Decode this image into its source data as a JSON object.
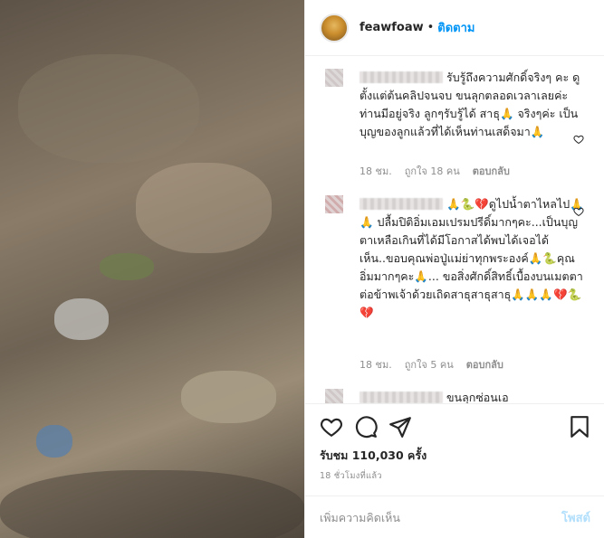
{
  "header": {
    "username": "feawfoaw",
    "separator": "•",
    "follow_label": "ติดตาม"
  },
  "comments": [
    {
      "text": "รับรู้ถึงความศักดิ์จริงๆ คะ ดูตั้งแต่ต้นคลิปจนจบ ขนลุกตลอดเวลาเลยค่ะ ท่านมีอยู่จริง ลูกๆรับรู้ได้ สาธุ🙏 จริงๆค่ะ เป็นบุญของลูกแล้วที่ได้เห็นท่านเสด็จมา🙏",
      "age": "18 ชม.",
      "likes": "ถูกใจ 18 คน",
      "reply": "ตอบกลับ"
    },
    {
      "text": "🙏🐍💔ดูไปน้ำตาไหลไป🙏🙏 ปลื้มปิติอิ่มเอมเปรมปรีดิ์มากๆคะ...เป็นบุญตาเหลือเกินที่ได้มีโอกาสได้พบได้เจอได้เห็น..ขอบคุณพ่อปู่แม่ย่าทุกพระองค์🙏🐍คุณอิ่มมากๆคะ🙏... ขอสิ่งศักดิ์สิทธิ์เบื้องบนเมตตาต่อข้าพเจ้าด้วยเถิดสาธุสาธุสาธุ🙏🙏🙏💔🐍💔",
      "age": "18 ชม.",
      "likes": "ถูกใจ 5 คน",
      "reply": "ตอบกลับ"
    },
    {
      "text": "ขนลุกซ่อนเอ",
      "age": "",
      "likes": "",
      "reply": ""
    }
  ],
  "actions": {
    "likes_text": "รับชม 110,030 ครั้ง",
    "time_text": "18 ชั่วโมงที่แล้ว"
  },
  "compose": {
    "placeholder": "เพิ่มความคิดเห็น",
    "post_label": "โพสต์"
  },
  "icons": [
    "heart-icon",
    "comment-icon",
    "share-icon",
    "bookmark-icon"
  ],
  "colors": {
    "link_blue": "#0095f6",
    "post_disabled": "#b2dffc",
    "muted": "#8e8e8e"
  }
}
